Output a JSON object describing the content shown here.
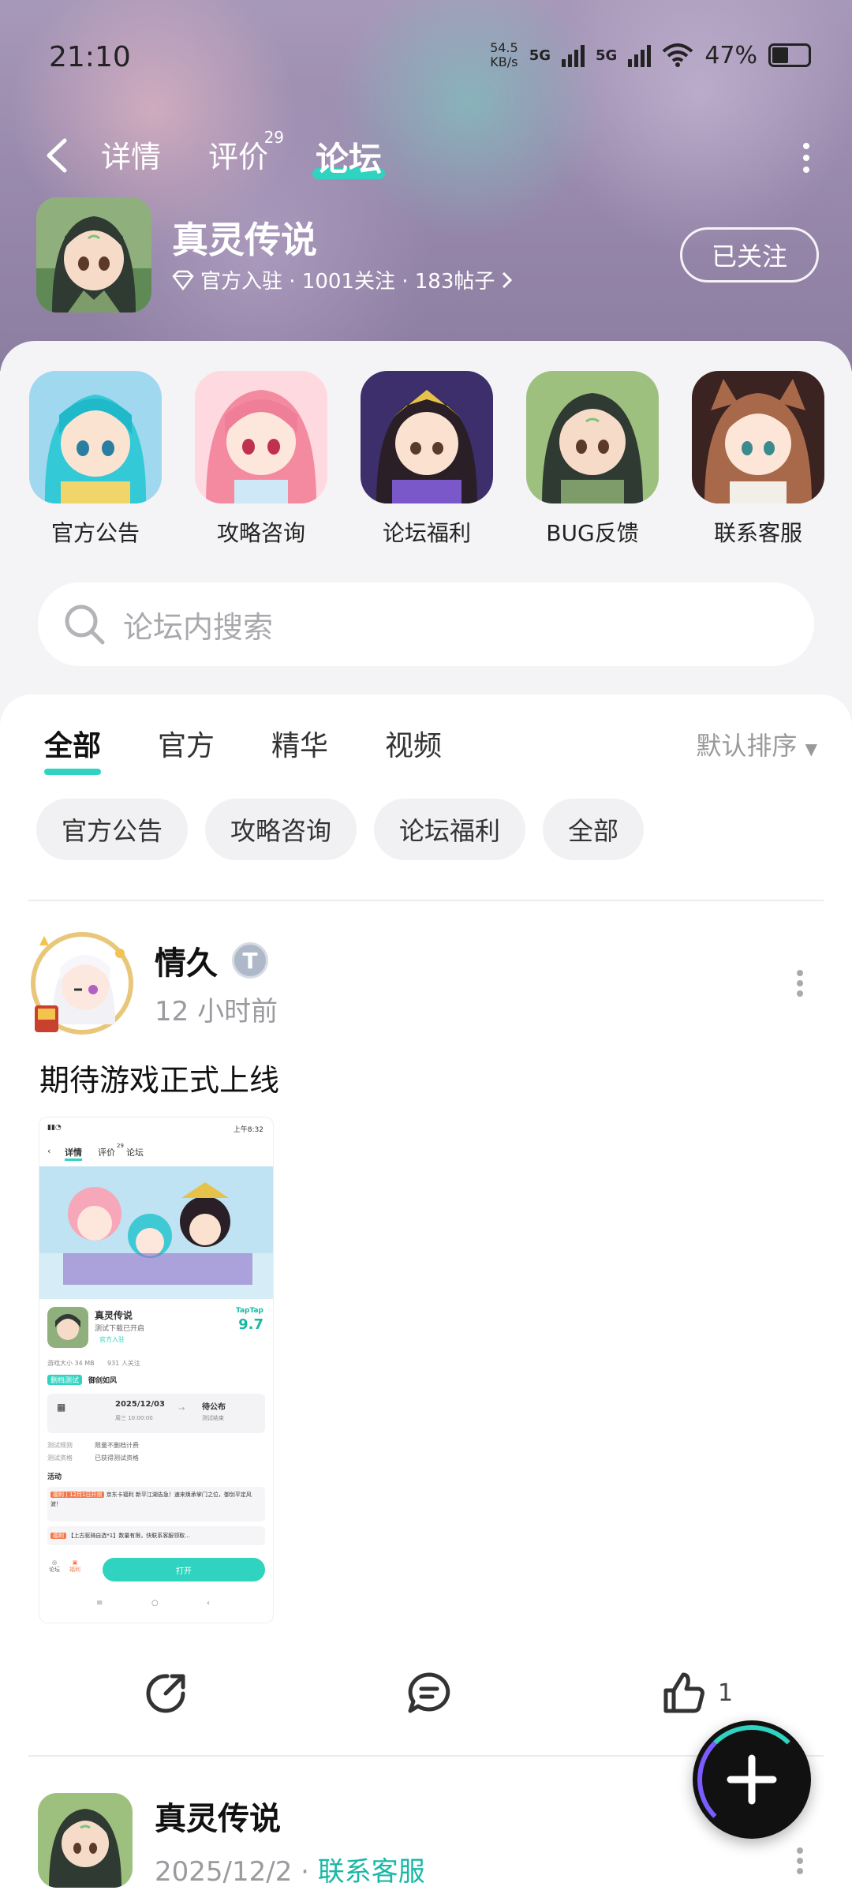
{
  "status_bar": {
    "time": "21:10",
    "net_speed_value": "54.5",
    "net_speed_unit": "KB/s",
    "sim1": "5G",
    "sim2": "5G",
    "battery": "47%"
  },
  "nav": {
    "tabs": [
      {
        "label": "详情"
      },
      {
        "label": "评价",
        "count": "29"
      },
      {
        "label": "论坛"
      }
    ],
    "active_tab": "论坛"
  },
  "game": {
    "name": "真灵传说",
    "meta": "官方入驻 · 1001关注 · 183帖子",
    "follow_label": "已关注"
  },
  "channels": [
    {
      "label": "官方公告"
    },
    {
      "label": "攻略咨询"
    },
    {
      "label": "论坛福利"
    },
    {
      "label": "BUG反馈"
    },
    {
      "label": "联系客服"
    }
  ],
  "search": {
    "placeholder": "论坛内搜索"
  },
  "feed_tabs": [
    {
      "label": "全部"
    },
    {
      "label": "官方"
    },
    {
      "label": "精华"
    },
    {
      "label": "视频"
    }
  ],
  "sort_label": "默认排序",
  "chips": [
    {
      "label": "官方公告"
    },
    {
      "label": "攻略咨询"
    },
    {
      "label": "论坛福利"
    },
    {
      "label": "全部"
    }
  ],
  "post": {
    "author": "情久",
    "badge": "T",
    "time_ago": "12 小时前",
    "text": "期待游戏正式上线",
    "like_count": "1",
    "screenshot": {
      "time": "上午8:32",
      "tabs": [
        "详情",
        "评价",
        "论坛"
      ],
      "tab_count": "29",
      "game_name": "真灵传说",
      "game_sub": "测试下载已开启",
      "official": "官方入驻",
      "score_brand": "TapTap",
      "score": "9.7",
      "size": "游戏大小 34 MB",
      "followers": "931 人关注",
      "test_tag": "删档测试",
      "test_name": "御剑如风",
      "date_start": "2025/12/03",
      "date_start_sub": "周三 10:00:00",
      "date_end": "待公布",
      "date_end_sub": "测试结束",
      "rule1_k": "测试规则",
      "rule1_v": "限量不删档计费",
      "rule2_k": "测试资格",
      "rule2_v": "已获得测试资格",
      "activity_label": "活动",
      "act1_tag": "福利丨12月1日开测",
      "act1_text": "京东卡福利 新平江湖告急！速来焕承掌门之位，御剑平定风波！",
      "act2_tag": "福利",
      "act2_text": "【上古驱骑自选*1】数量有限，快联系客服领取...",
      "bottom_left1": "论坛",
      "bottom_left2": "福利",
      "open_label": "打开"
    }
  },
  "post2": {
    "name": "真灵传说",
    "date": "2025/12/2",
    "separator": "·",
    "link": "联系客服"
  },
  "colors": {
    "accent": "#2fd3c0",
    "link": "#19b8a6"
  }
}
